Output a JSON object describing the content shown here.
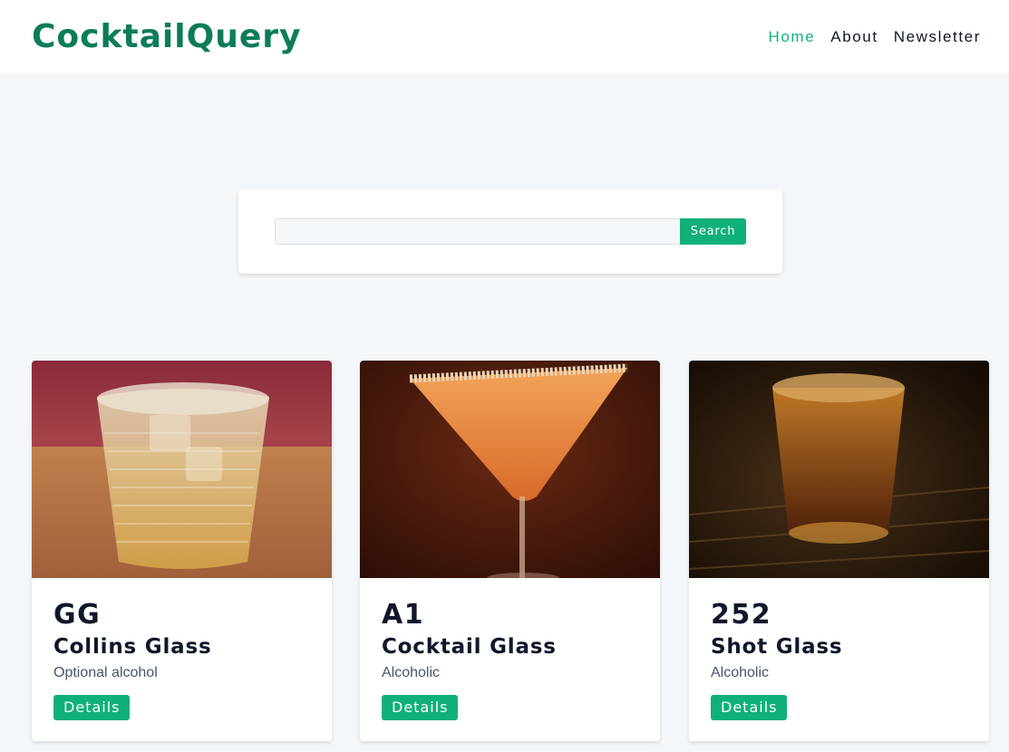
{
  "brand": {
    "name": "CocktailQuery"
  },
  "nav": {
    "links": [
      {
        "label": "Home",
        "active": true
      },
      {
        "label": "About",
        "active": false
      },
      {
        "label": "Newsletter",
        "active": false
      }
    ]
  },
  "search": {
    "value": "",
    "placeholder": "",
    "button_label": "Search"
  },
  "cocktails": [
    {
      "name": "GG",
      "glass": "Collins Glass",
      "info": "Optional alcohol",
      "button_label": "Details"
    },
    {
      "name": "A1",
      "glass": "Cocktail Glass",
      "info": "Alcoholic",
      "button_label": "Details"
    },
    {
      "name": "252",
      "glass": "Shot Glass",
      "info": "Alcoholic",
      "button_label": "Details"
    }
  ],
  "colors": {
    "brand": "#0c7c59",
    "accent": "#10b079",
    "background": "#f4f7f9"
  }
}
